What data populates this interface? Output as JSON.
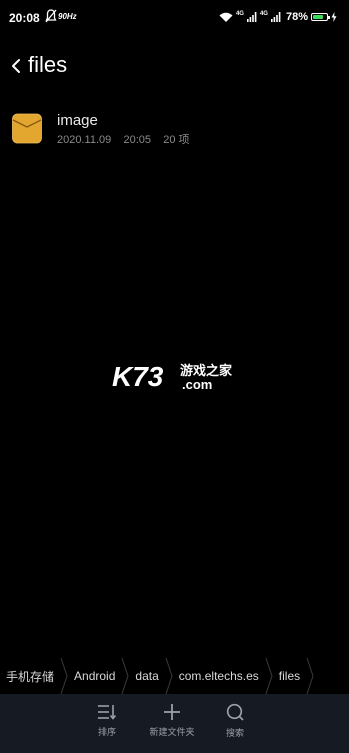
{
  "status_bar": {
    "time": "20:08",
    "refresh_rate": "90Hz",
    "network_1": "4G",
    "network_2": "4G",
    "battery_percent": "78%",
    "battery_level": 0.78,
    "battery_color": "#3fdc5a"
  },
  "header": {
    "title": "files"
  },
  "files": [
    {
      "name": "image",
      "date": "2020.11.09",
      "time": "20:05",
      "count": "20 项",
      "icon": "folder-icon",
      "icon_color": "#e3a72f"
    }
  ],
  "watermark": {
    "brand": "K73",
    "text_top": "游戏之家",
    "text_bottom": ".com"
  },
  "breadcrumb": [
    "手机存储",
    "Android",
    "data",
    "com.eltechs.es",
    "files"
  ],
  "toolbar": {
    "sort_label": "排序",
    "new_folder_label": "新建文件夹",
    "search_label": "搜索"
  }
}
